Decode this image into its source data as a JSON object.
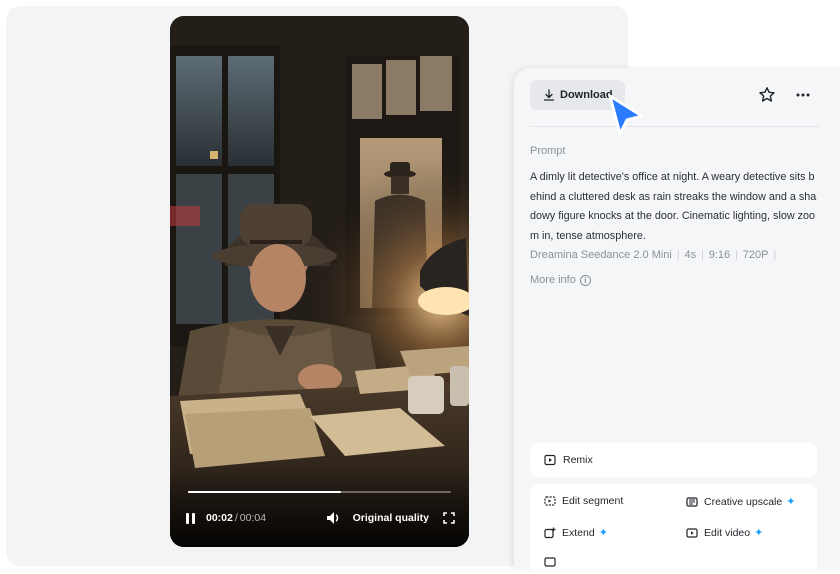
{
  "player": {
    "current_time": "00:02",
    "separator": "/",
    "duration": "00:04",
    "quality_label": "Original quality",
    "progress": 0.58,
    "play_state_icon": "pause-icon"
  },
  "toolbar": {
    "download_label": "Download",
    "favorite_icon": "star-icon",
    "more_icon": "more-icon"
  },
  "details": {
    "prompt_label": "Prompt",
    "prompt_text": "A dimly lit detective's office at night. A weary detective sits behind a cluttered desk as rain streaks the window and a shadowy figure knocks at the door. Cinematic lighting, slow zoom in, tense atmosphere.",
    "meta": [
      "Dreamina Seedance 2.0 Mini",
      "4s",
      "9:16",
      "720P"
    ],
    "more_info_label": "More info"
  },
  "actions": {
    "remix_label": "Remix",
    "tools": [
      {
        "label": "Edit segment",
        "premium": false
      },
      {
        "label": "Creative upscale",
        "premium": true
      },
      {
        "label": "Extend",
        "premium": true
      },
      {
        "label": "Edit video",
        "premium": true
      }
    ]
  },
  "colors": {
    "accent_blue": "#1aa0ff",
    "cursor_blue": "#2b7bff",
    "panel_bg": "#f5f6f8"
  }
}
